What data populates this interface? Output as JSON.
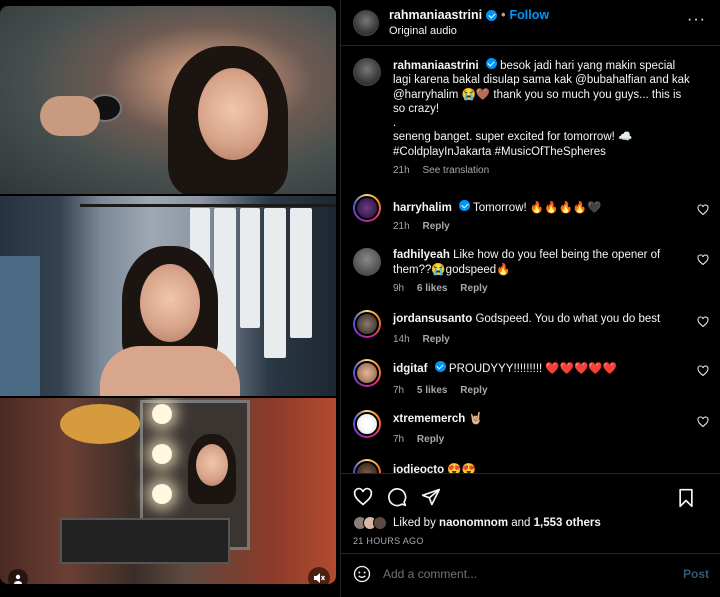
{
  "header": {
    "username": "rahmaniaastrini",
    "separator": "•",
    "follow_label": "Follow",
    "audio_label": "Original audio",
    "more_icon": "more-icon"
  },
  "caption": {
    "username": "rahmaniaastrini",
    "text_line1": "besok jadi hari yang makin special lagi karena bakal disulap sama kak @bubahalfian and kak @harryhalim 😭🤎 thank you so much you guys... this is so crazy!",
    "text_dot": ".",
    "text_line2": "seneng banget. super excited for tomorrow! ☁️",
    "text_line3": "#ColdplayInJakarta #MusicOfTheSpheres",
    "time": "21h",
    "translation": "See translation"
  },
  "comments": [
    {
      "username": "harryhalim",
      "verified": true,
      "text": "Tomorrow! 🔥🔥🔥🔥🖤",
      "time": "21h",
      "likes": "",
      "reply": "Reply"
    },
    {
      "username": "fadhilyeah",
      "verified": false,
      "text": "Like how do you feel being the opener of them??😭godspeed🔥",
      "time": "9h",
      "likes": "6 likes",
      "reply": "Reply"
    },
    {
      "username": "jordansusanto",
      "verified": false,
      "text": "Godspeed. You do what you do best",
      "time": "14h",
      "likes": "",
      "reply": "Reply"
    },
    {
      "username": "idgitaf",
      "verified": true,
      "text": "PROUDYYY!!!!!!!!! ❤️❤️❤️❤️❤️",
      "time": "7h",
      "likes": "5 likes",
      "reply": "Reply"
    },
    {
      "username": "xtrememerch",
      "verified": false,
      "text": "🤘🏼",
      "time": "7h",
      "likes": "",
      "reply": "Reply"
    },
    {
      "username": "jodieocto",
      "verified": false,
      "text": "😍😍",
      "time": "",
      "likes": "",
      "reply": ""
    }
  ],
  "actions": {
    "liked_prefix": "Liked by",
    "liked_user": "naonomnom",
    "liked_and": "and",
    "liked_count": "1,553 others",
    "date": "21 HOURS AGO"
  },
  "add_comment": {
    "placeholder": "Add a comment...",
    "post_label": "Post"
  },
  "colors": {
    "accent": "#0095f6",
    "background": "#000000",
    "muted": "#a8a8a8",
    "divider": "#262626"
  }
}
